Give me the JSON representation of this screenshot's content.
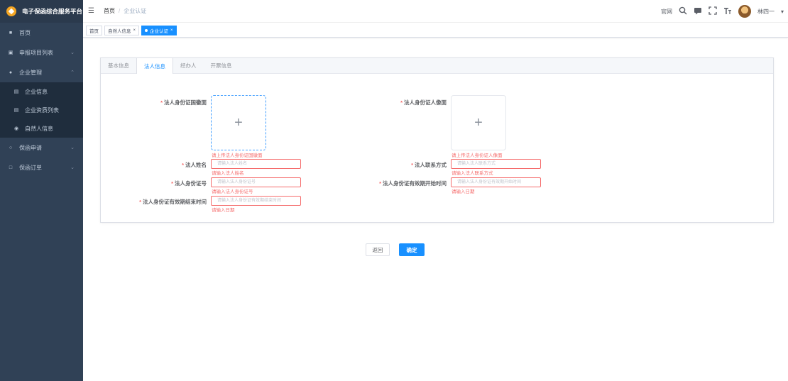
{
  "app": {
    "title": "电子保函综合服务平台"
  },
  "sidebar": {
    "items": [
      {
        "icon": "home-icon",
        "label": "首页"
      },
      {
        "icon": "list-icon",
        "label": "申报项目列表"
      },
      {
        "icon": "user-icon",
        "label": "企业管理",
        "expanded": true,
        "children": [
          {
            "icon": "doc-icon",
            "label": "企业信息"
          },
          {
            "icon": "doc-icon",
            "label": "企业资质列表"
          },
          {
            "icon": "person-icon",
            "label": "自然人信息"
          }
        ]
      },
      {
        "icon": "apply-icon",
        "label": "保函申请"
      },
      {
        "icon": "order-icon",
        "label": "保函订单"
      }
    ]
  },
  "navbar": {
    "breadcrumb": [
      "首页",
      "企业认证"
    ],
    "right": {
      "official_site": "官网",
      "username": "林四一"
    }
  },
  "tags": [
    {
      "label": "首页",
      "active": false,
      "closable": false
    },
    {
      "label": "自然人信息",
      "active": false,
      "closable": true
    },
    {
      "label": "企业认证",
      "active": true,
      "closable": true
    }
  ],
  "tabs": [
    "基本信息",
    "法人信息",
    "经办人",
    "开票信息"
  ],
  "active_tab": "法人信息",
  "form": {
    "id_back": {
      "label": "法人身份证国徽面",
      "error": "请上传法人身份证国徽面"
    },
    "id_front": {
      "label": "法人身份证人像面",
      "error": "请上传法人身份证人像面"
    },
    "name": {
      "label": "法人姓名",
      "placeholder": "请输入法人姓名",
      "error": "请输入法人姓名"
    },
    "phone": {
      "label": "法人联系方式",
      "placeholder": "请输入法人联系方式",
      "error": "请输入法人联系方式"
    },
    "id_number": {
      "label": "法人身份证号",
      "placeholder": "请输入法人身份证号",
      "error": "请输入法人身份证号"
    },
    "valid_start": {
      "label": "法人身份证有效期开始时间",
      "placeholder": "请输入法人身份证有效期开始时间",
      "error": "请输入日期"
    },
    "valid_end": {
      "label": "法人身份证有效期结束时间",
      "placeholder": "请输入法人身份证有效期结束时间",
      "error": "请输入日期"
    },
    "required_mark": "*",
    "upload_plus": "+"
  },
  "buttons": {
    "back": "返回",
    "confirm": "确定"
  },
  "colors": {
    "sidebar_bg": "#304156",
    "primary": "#1890ff",
    "error": "#f56c6c"
  }
}
